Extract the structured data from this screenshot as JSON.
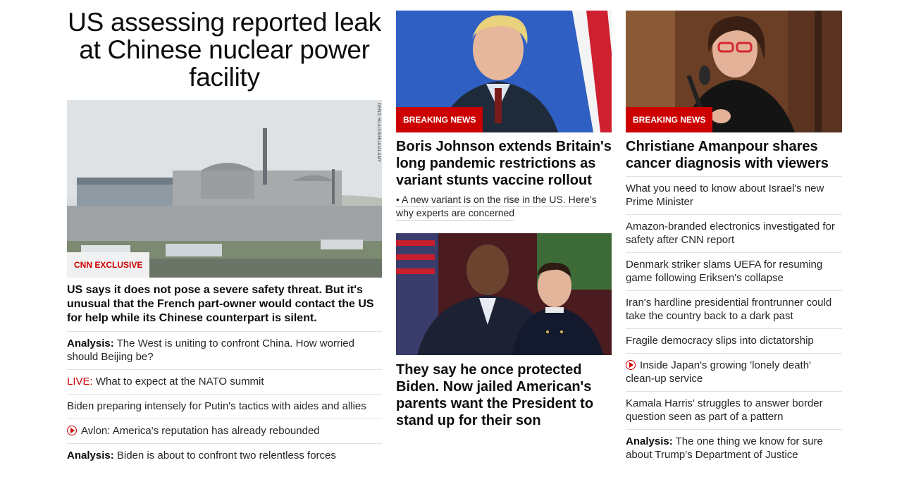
{
  "left": {
    "headline": "US assessing reported leak at Chinese nuclear power facility",
    "photo_credit": "DENG HUA/XINHUA/ALAMY",
    "badge": "CNN EXCLUSIVE",
    "lede": "US says it does not pose a severe safety threat. But it's unusual that the French part-owner would contact the US for help while its Chinese counterpart is silent.",
    "links": [
      {
        "prefix": "Analysis:",
        "text": "The West is uniting to confront China. How worried should Beijing be?"
      },
      {
        "live": "LIVE:",
        "text": "What to expect at the NATO summit"
      },
      {
        "text": "Biden preparing intensely for Putin's tactics with aides and allies"
      },
      {
        "video": true,
        "text": "Avlon: America's reputation has already rebounded"
      },
      {
        "prefix": "Analysis:",
        "text": "Biden is about to confront two relentless forces"
      }
    ]
  },
  "mid": {
    "story1": {
      "badge": "BREAKING NEWS",
      "title": "Boris Johnson extends Britain's long pandemic restrictions as variant stunts vaccine rollout",
      "sublink": "• A new variant is on the rise in the US. Here's why experts are concerned"
    },
    "story2": {
      "title": "They say he once protected Biden. Now jailed American's parents want the President to stand up for their son"
    }
  },
  "right": {
    "badge": "BREAKING NEWS",
    "title": "Christiane Amanpour shares cancer diagnosis with viewers",
    "links": [
      {
        "text": "What you need to know about Israel's new Prime Minister"
      },
      {
        "text": "Amazon-branded electronics investigated for safety after CNN report"
      },
      {
        "text": "Denmark striker slams UEFA for resuming game following Eriksen's collapse"
      },
      {
        "text": "Iran's hardline presidential frontrunner could take the country back to a dark past"
      },
      {
        "text": "Fragile democracy slips into dictatorship"
      },
      {
        "video": true,
        "text": "Inside Japan's growing 'lonely death' clean-up service"
      },
      {
        "text": "Kamala Harris' struggles to answer border question seen as part of a pattern"
      },
      {
        "prefix": "Analysis:",
        "text": "The one thing we know for sure about Trump's Department of Justice"
      }
    ]
  },
  "colors": {
    "accent_red": "#cc0000",
    "divider": "#e1e1e1"
  }
}
